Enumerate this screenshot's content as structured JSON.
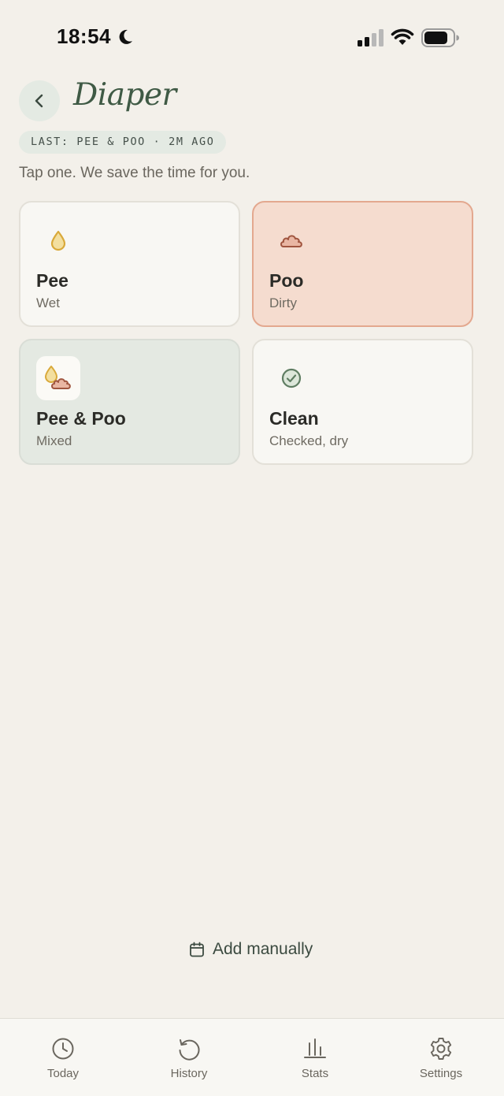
{
  "status_bar": {
    "time": "18:54"
  },
  "header": {
    "title": "Diaper",
    "last_badge": "LAST: PEE & POO · 2M AGO",
    "hint": "Tap one. We save the time for you."
  },
  "options": [
    {
      "title": "Pee",
      "subtitle": "Wet",
      "icon": "droplet-icon"
    },
    {
      "title": "Poo",
      "subtitle": "Dirty",
      "icon": "poo-cloud-icon",
      "selected": true
    },
    {
      "title": "Pee & Poo",
      "subtitle": "Mixed",
      "icon": "droplet-cloud-icon"
    },
    {
      "title": "Clean",
      "subtitle": "Checked, dry",
      "icon": "check-circle-icon"
    }
  ],
  "add_manually": {
    "label": "Add manually",
    "icon": "calendar-icon"
  },
  "tab_bar": {
    "items": [
      {
        "label": "Today",
        "icon": "clock-icon"
      },
      {
        "label": "History",
        "icon": "history-icon"
      },
      {
        "label": "Stats",
        "icon": "bar-chart-icon"
      },
      {
        "label": "Settings",
        "icon": "gear-icon"
      }
    ]
  },
  "colors": {
    "background": "#f3f0ea",
    "accent_green": "#3f5a45",
    "poo_selected_bg": "#f5dccf",
    "mixed_bg": "#e4e9e2",
    "pee_yellow": "#d9a93a",
    "poo_brown": "#a0553f"
  }
}
